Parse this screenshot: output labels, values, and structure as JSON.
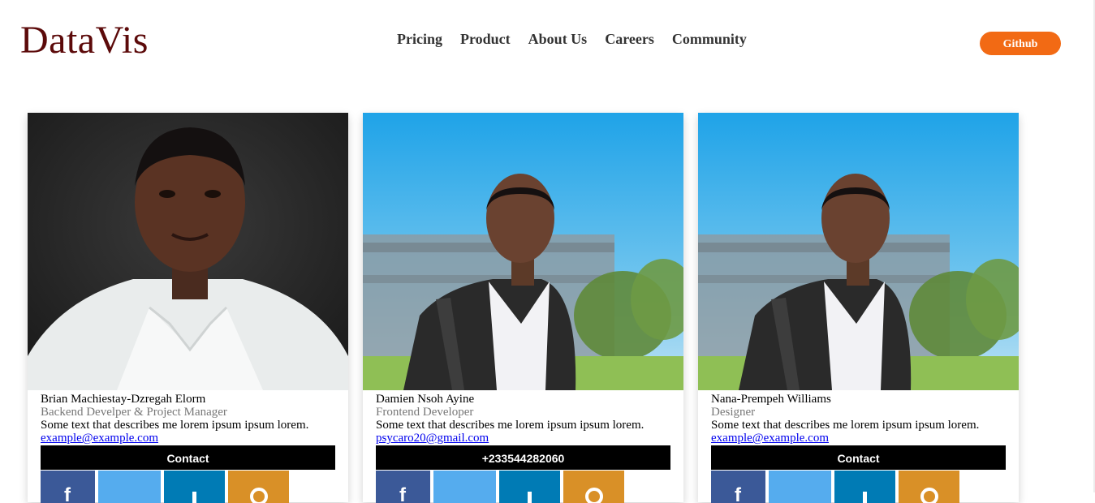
{
  "brand": {
    "logo": "DataVis"
  },
  "nav": {
    "items": [
      "Pricing",
      "Product",
      "About Us",
      "Careers",
      "Community"
    ]
  },
  "header": {
    "github_label": "Github",
    "accent": "#f26a14",
    "logo_color": "#5c0a0a"
  },
  "cards": [
    {
      "name": "Brian Machiestay-Dzregah Elorm",
      "role": "Backend Develper & Project Manager",
      "description": "Some text that describes me lorem ipsum ipsum lorem.",
      "email": "example@example.com",
      "button": "Contact"
    },
    {
      "name": "Damien Nsoh Ayine",
      "role": "Frontend Developer",
      "description": "Some text that describes me lorem ipsum ipsum lorem.",
      "email": "psycaro20@gmail.com",
      "button": "+233544282060"
    },
    {
      "name": "Nana-Prempeh Williams",
      "role": "Designer",
      "description": "Some text that describes me lorem ipsum ipsum lorem.",
      "email": "example@example.com",
      "button": "Contact"
    }
  ],
  "social": {
    "icons": [
      "facebook-icon",
      "twitter-icon",
      "linkedin-icon",
      "rss-icon"
    ],
    "colors": [
      "#3b5998",
      "#55acee",
      "#007bb5",
      "#d99027"
    ]
  }
}
